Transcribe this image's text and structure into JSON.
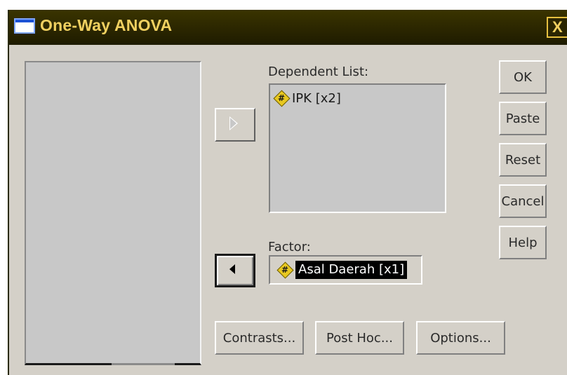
{
  "window": {
    "title": "One-Way ANOVA",
    "close_label": "X"
  },
  "dependent": {
    "label": "Dependent List:",
    "items": [
      {
        "icon": "scale-variable-icon",
        "glyph": "#",
        "label": "IPK [x2]"
      }
    ]
  },
  "factor": {
    "label": "Factor:",
    "item": {
      "icon": "scale-variable-icon",
      "glyph": "#",
      "label": "Asal Daerah [x1]"
    }
  },
  "buttons": {
    "ok": "OK",
    "paste": "Paste",
    "reset": "Reset",
    "cancel": "Cancel",
    "help": "Help",
    "contrasts": "Contrasts...",
    "post_hoc": "Post Hoc...",
    "options": "Options..."
  },
  "colors": {
    "titlebar": "#2f2a00",
    "title_text": "#f0d060",
    "dialog_bg": "#d4d0c8",
    "selection_bg": "#000000"
  }
}
